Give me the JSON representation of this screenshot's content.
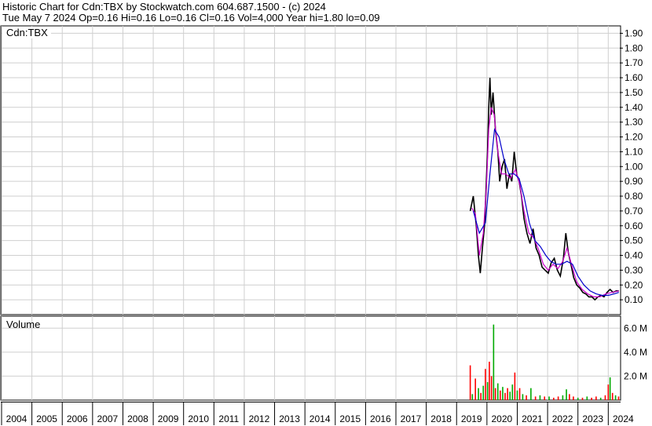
{
  "header": {
    "line1": "Historic Chart for Cdn:TBX by Stockwatch.com 604.687.1500 - (c) 2024",
    "line2": "Tue May  7 2024  Op=0.16  Hi=0.16  Lo=0.16  Cl=0.16  Vol=4,000  Year hi=1.80  lo=0.09"
  },
  "chart_data": [
    {
      "type": "line",
      "panel": "price",
      "label": "Cdn:TBX",
      "ylim": [
        0.0,
        1.95
      ],
      "yticks": [
        0.1,
        0.2,
        0.3,
        0.4,
        0.5,
        0.6,
        0.7,
        0.8,
        0.9,
        1.0,
        1.1,
        1.2,
        1.3,
        1.4,
        1.5,
        1.6,
        1.7,
        1.8,
        1.9
      ],
      "ytick_labels": [
        "0.10",
        "0.20",
        "0.30",
        "0.40",
        "0.50",
        "0.60",
        "0.70",
        "0.80",
        "0.90",
        "1.00",
        "1.10",
        "1.20",
        "1.30",
        "1.40",
        "1.50",
        "1.60",
        "1.70",
        "1.80",
        "1.90"
      ],
      "xlim": [
        2004.0,
        2024.38
      ],
      "xticks": [
        "2004",
        "2005",
        "2006",
        "2007",
        "2008",
        "2009",
        "2010",
        "2011",
        "2012",
        "2013",
        "2014",
        "2015",
        "2016",
        "2017",
        "2018",
        "2019",
        "2020",
        "2021",
        "2022",
        "2023",
        "2024"
      ],
      "grid": true,
      "series": [
        {
          "color": "#000000",
          "points": [
            [
              2019.45,
              0.7
            ],
            [
              2019.55,
              0.8
            ],
            [
              2019.65,
              0.6
            ],
            [
              2019.72,
              0.4
            ],
            [
              2019.78,
              0.28
            ],
            [
              2019.85,
              0.45
            ],
            [
              2019.92,
              0.6
            ],
            [
              2019.98,
              0.9
            ],
            [
              2020.02,
              1.1
            ],
            [
              2020.06,
              1.4
            ],
            [
              2020.1,
              1.6
            ],
            [
              2020.14,
              1.35
            ],
            [
              2020.2,
              1.5
            ],
            [
              2020.28,
              1.25
            ],
            [
              2020.36,
              1.1
            ],
            [
              2020.42,
              0.9
            ],
            [
              2020.5,
              1.0
            ],
            [
              2020.58,
              1.05
            ],
            [
              2020.66,
              0.85
            ],
            [
              2020.74,
              0.95
            ],
            [
              2020.82,
              0.9
            ],
            [
              2020.9,
              1.1
            ],
            [
              2020.98,
              0.95
            ],
            [
              2021.06,
              0.9
            ],
            [
              2021.14,
              0.8
            ],
            [
              2021.22,
              0.65
            ],
            [
              2021.32,
              0.55
            ],
            [
              2021.42,
              0.48
            ],
            [
              2021.52,
              0.58
            ],
            [
              2021.62,
              0.45
            ],
            [
              2021.72,
              0.4
            ],
            [
              2021.82,
              0.32
            ],
            [
              2021.92,
              0.3
            ],
            [
              2022.02,
              0.28
            ],
            [
              2022.12,
              0.35
            ],
            [
              2022.22,
              0.38
            ],
            [
              2022.32,
              0.3
            ],
            [
              2022.42,
              0.26
            ],
            [
              2022.52,
              0.38
            ],
            [
              2022.6,
              0.55
            ],
            [
              2022.68,
              0.42
            ],
            [
              2022.76,
              0.35
            ],
            [
              2022.86,
              0.25
            ],
            [
              2022.96,
              0.2
            ],
            [
              2023.06,
              0.18
            ],
            [
              2023.16,
              0.15
            ],
            [
              2023.26,
              0.14
            ],
            [
              2023.36,
              0.12
            ],
            [
              2023.46,
              0.12
            ],
            [
              2023.56,
              0.1
            ],
            [
              2023.66,
              0.12
            ],
            [
              2023.76,
              0.13
            ],
            [
              2023.86,
              0.12
            ],
            [
              2023.96,
              0.15
            ],
            [
              2024.06,
              0.17
            ],
            [
              2024.16,
              0.15
            ],
            [
              2024.26,
              0.16
            ],
            [
              2024.35,
              0.16
            ]
          ]
        },
        {
          "color": "#cc00cc",
          "points": [
            [
              2019.5,
              0.72
            ],
            [
              2019.62,
              0.68
            ],
            [
              2019.75,
              0.4
            ],
            [
              2019.88,
              0.55
            ],
            [
              2019.98,
              0.85
            ],
            [
              2020.06,
              1.25
            ],
            [
              2020.14,
              1.4
            ],
            [
              2020.24,
              1.35
            ],
            [
              2020.36,
              1.1
            ],
            [
              2020.48,
              0.95
            ],
            [
              2020.62,
              0.95
            ],
            [
              2020.78,
              0.92
            ],
            [
              2020.94,
              0.98
            ],
            [
              2021.08,
              0.88
            ],
            [
              2021.22,
              0.7
            ],
            [
              2021.38,
              0.55
            ],
            [
              2021.54,
              0.52
            ],
            [
              2021.7,
              0.44
            ],
            [
              2021.86,
              0.34
            ],
            [
              2022.02,
              0.3
            ],
            [
              2022.18,
              0.34
            ],
            [
              2022.34,
              0.31
            ],
            [
              2022.5,
              0.36
            ],
            [
              2022.64,
              0.45
            ],
            [
              2022.8,
              0.33
            ],
            [
              2022.96,
              0.22
            ],
            [
              2023.14,
              0.17
            ],
            [
              2023.32,
              0.14
            ],
            [
              2023.52,
              0.12
            ],
            [
              2023.72,
              0.12
            ],
            [
              2023.92,
              0.14
            ],
            [
              2024.12,
              0.15
            ],
            [
              2024.35,
              0.16
            ]
          ]
        },
        {
          "color": "#0000cc",
          "points": [
            [
              2019.55,
              0.7
            ],
            [
              2019.75,
              0.55
            ],
            [
              2019.95,
              0.62
            ],
            [
              2020.1,
              0.95
            ],
            [
              2020.25,
              1.25
            ],
            [
              2020.4,
              1.2
            ],
            [
              2020.56,
              1.05
            ],
            [
              2020.72,
              0.95
            ],
            [
              2020.9,
              0.95
            ],
            [
              2021.06,
              0.92
            ],
            [
              2021.22,
              0.8
            ],
            [
              2021.4,
              0.62
            ],
            [
              2021.58,
              0.5
            ],
            [
              2021.76,
              0.46
            ],
            [
              2021.94,
              0.4
            ],
            [
              2022.1,
              0.36
            ],
            [
              2022.28,
              0.34
            ],
            [
              2022.46,
              0.34
            ],
            [
              2022.64,
              0.36
            ],
            [
              2022.82,
              0.34
            ],
            [
              2023.0,
              0.26
            ],
            [
              2023.2,
              0.2
            ],
            [
              2023.4,
              0.16
            ],
            [
              2023.6,
              0.14
            ],
            [
              2023.8,
              0.13
            ],
            [
              2024.0,
              0.13
            ],
            [
              2024.2,
              0.14
            ],
            [
              2024.35,
              0.15
            ]
          ]
        }
      ]
    },
    {
      "type": "bar",
      "panel": "volume",
      "label": "Volume",
      "ylim": [
        0,
        7.0
      ],
      "yticks": [
        2.0,
        4.0,
        6.0
      ],
      "ytick_labels": [
        "2.0 M",
        "4.0 M",
        "6.0 M"
      ],
      "xlim": [
        2004.0,
        2024.38
      ],
      "grid": true,
      "bars": [
        [
          2019.45,
          2.9,
          "#ff0000"
        ],
        [
          2019.52,
          0.5,
          "#00aa00"
        ],
        [
          2019.62,
          1.8,
          "#ff0000"
        ],
        [
          2019.72,
          1.0,
          "#00aa00"
        ],
        [
          2019.8,
          0.6,
          "#ff0000"
        ],
        [
          2019.88,
          1.2,
          "#00aa00"
        ],
        [
          2019.95,
          2.6,
          "#ff0000"
        ],
        [
          2020.02,
          1.5,
          "#00aa00"
        ],
        [
          2020.08,
          3.2,
          "#ff0000"
        ],
        [
          2020.15,
          2.0,
          "#ff0000"
        ],
        [
          2020.22,
          6.3,
          "#00aa00"
        ],
        [
          2020.28,
          1.0,
          "#ff0000"
        ],
        [
          2020.36,
          1.4,
          "#00aa00"
        ],
        [
          2020.44,
          0.8,
          "#ff0000"
        ],
        [
          2020.52,
          1.1,
          "#00aa00"
        ],
        [
          2020.6,
          0.6,
          "#ff0000"
        ],
        [
          2020.68,
          1.0,
          "#ff0000"
        ],
        [
          2020.76,
          0.7,
          "#00aa00"
        ],
        [
          2020.84,
          1.3,
          "#00aa00"
        ],
        [
          2020.92,
          2.3,
          "#ff0000"
        ],
        [
          2021.0,
          0.8,
          "#00aa00"
        ],
        [
          2021.08,
          1.0,
          "#ff0000"
        ],
        [
          2021.18,
          0.5,
          "#00aa00"
        ],
        [
          2021.3,
          0.4,
          "#ff0000"
        ],
        [
          2021.45,
          1.0,
          "#00aa00"
        ],
        [
          2021.6,
          0.3,
          "#ff0000"
        ],
        [
          2021.75,
          0.4,
          "#00aa00"
        ],
        [
          2021.9,
          0.3,
          "#ff0000"
        ],
        [
          2022.05,
          0.3,
          "#00aa00"
        ],
        [
          2022.2,
          0.2,
          "#ff0000"
        ],
        [
          2022.35,
          0.3,
          "#ff0000"
        ],
        [
          2022.5,
          0.4,
          "#00aa00"
        ],
        [
          2022.62,
          0.9,
          "#00aa00"
        ],
        [
          2022.72,
          0.5,
          "#ff0000"
        ],
        [
          2022.85,
          0.3,
          "#ff0000"
        ],
        [
          2023.0,
          0.2,
          "#00aa00"
        ],
        [
          2023.15,
          0.2,
          "#ff0000"
        ],
        [
          2023.3,
          0.3,
          "#00aa00"
        ],
        [
          2023.45,
          0.2,
          "#ff0000"
        ],
        [
          2023.6,
          0.3,
          "#ff0000"
        ],
        [
          2023.75,
          0.2,
          "#00aa00"
        ],
        [
          2023.9,
          0.4,
          "#ff0000"
        ],
        [
          2024.0,
          1.3,
          "#ff0000"
        ],
        [
          2024.06,
          1.9,
          "#00aa00"
        ],
        [
          2024.14,
          0.6,
          "#ff0000"
        ],
        [
          2024.24,
          0.4,
          "#00aa00"
        ],
        [
          2024.34,
          0.3,
          "#ff0000"
        ]
      ]
    }
  ]
}
